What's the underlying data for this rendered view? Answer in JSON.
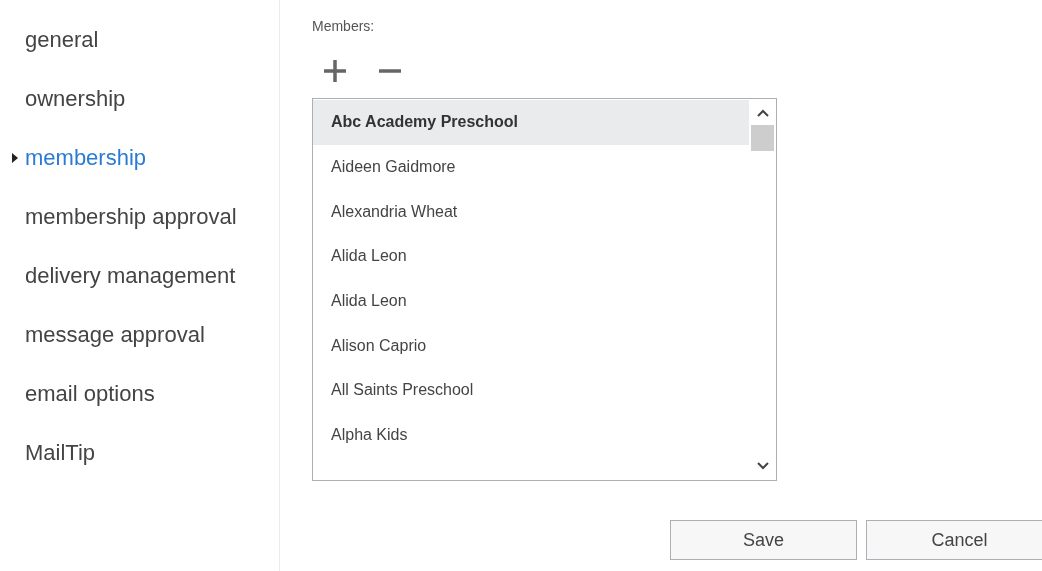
{
  "sidebar": {
    "items": [
      {
        "label": "general",
        "selected": false
      },
      {
        "label": "ownership",
        "selected": false
      },
      {
        "label": "membership",
        "selected": true
      },
      {
        "label": "membership approval",
        "selected": false
      },
      {
        "label": "delivery management",
        "selected": false
      },
      {
        "label": "message approval",
        "selected": false
      },
      {
        "label": "email options",
        "selected": false
      },
      {
        "label": "MailTip",
        "selected": false
      }
    ]
  },
  "members": {
    "label": "Members:",
    "list": [
      {
        "name": "Abc Academy Preschool",
        "selected": true
      },
      {
        "name": "Aideen Gaidmore",
        "selected": false
      },
      {
        "name": "Alexandria Wheat",
        "selected": false
      },
      {
        "name": "Alida Leon",
        "selected": false
      },
      {
        "name": "Alida Leon",
        "selected": false
      },
      {
        "name": "Alison Caprio",
        "selected": false
      },
      {
        "name": "All Saints Preschool",
        "selected": false
      },
      {
        "name": "Alpha Kids",
        "selected": false
      }
    ]
  },
  "buttons": [
    "Save",
    "Cancel"
  ]
}
